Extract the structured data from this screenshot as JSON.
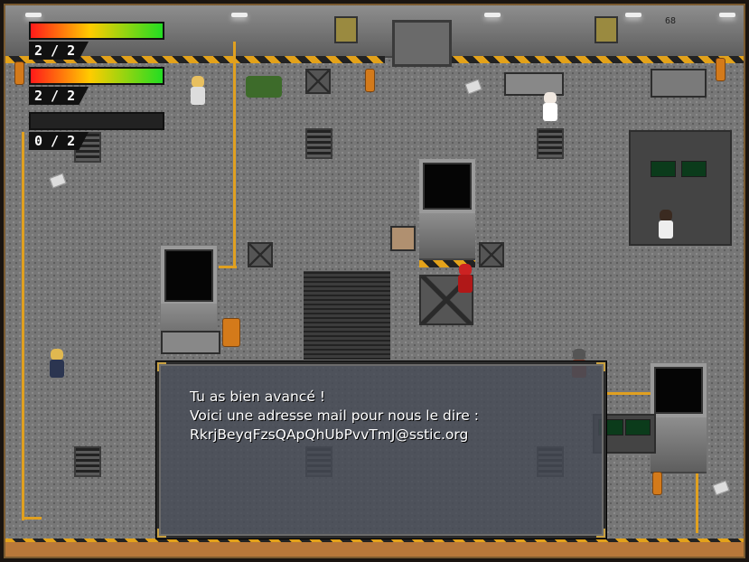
{
  "hud": {
    "bars": [
      {
        "value": "2 / 2",
        "fill": 1.0
      },
      {
        "value": "2 / 2",
        "fill": 1.0
      },
      {
        "value": "0 / 2",
        "fill": 0.0
      }
    ]
  },
  "wall_number": "68",
  "dialog": {
    "lines": [
      "Tu as bien avancé !",
      "Voici une adresse mail pour nous le dire :",
      "RkrjBeyqFzsQApQhUbPvvTmJ@sstic.org"
    ]
  },
  "colors": {
    "hazard_yellow": "#e3a21a",
    "pipe": "#e0a020",
    "floor": "#777777",
    "hp_red": "#ff1a1a",
    "hp_green": "#22dd22"
  }
}
